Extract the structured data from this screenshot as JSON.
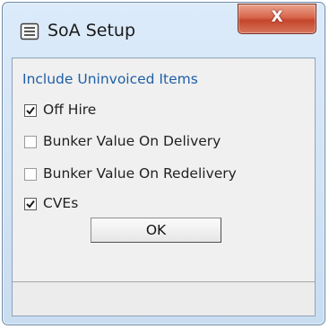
{
  "window": {
    "title": "SoA Setup",
    "close_glyph": "X",
    "icon": "document-lines-icon"
  },
  "dialog": {
    "section_heading": "Include Uninvoiced Items",
    "checkboxes": [
      {
        "label": "Off Hire",
        "checked": true
      },
      {
        "label": "Bunker Value On Delivery",
        "checked": false
      },
      {
        "label": "Bunker Value On Redelivery",
        "checked": false
      },
      {
        "label": "CVEs",
        "checked": true
      }
    ],
    "ok_label": "OK"
  },
  "colors": {
    "heading_text": "#1f5fa8",
    "title_bar": "#c9ddf1",
    "close_button": "#c4452b",
    "client_background": "#f0f0f0"
  }
}
